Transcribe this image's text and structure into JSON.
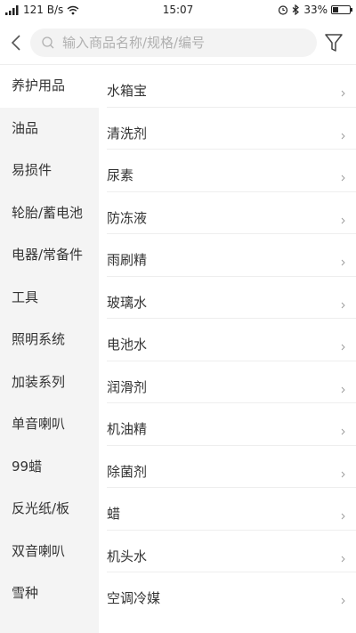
{
  "status_bar": {
    "signal": "᯾",
    "net_speed": "121 B/s",
    "time": "15:07",
    "battery_percent_text": "33%",
    "battery_level": 0.33
  },
  "search": {
    "placeholder": "输入商品名称/规格/编号",
    "value": ""
  },
  "icons": {
    "back": "chevron-left-icon",
    "search": "search-icon",
    "filter": "filter-icon",
    "wifi": "wifi-icon",
    "alarm": "alarm-icon",
    "bluetooth": "bluetooth-icon",
    "battery": "battery-icon",
    "item_arrow": "chevron-right-icon"
  },
  "categories": [
    "养护用品",
    "油品",
    "易损件",
    "轮胎/蓄电池",
    "电器/常备件",
    "工具",
    "照明系统",
    "加装系列",
    "单音喇叭",
    "99蜡",
    "反光纸/板",
    "双音喇叭",
    "雪种"
  ],
  "active_category_index": 0,
  "items": [
    "水箱宝",
    "清洗剂",
    "尿素",
    "防冻液",
    "雨刷精",
    "玻璃水",
    "电池水",
    "润滑剂",
    "机油精",
    "除菌剂",
    "蜡",
    "机头水",
    "空调冷媒"
  ],
  "colors": {
    "sidebar_bg": "#f4f4f4",
    "active_bg": "#ffffff",
    "divider": "#eeeeee",
    "text": "#333333",
    "placeholder": "#b0b0b0"
  }
}
